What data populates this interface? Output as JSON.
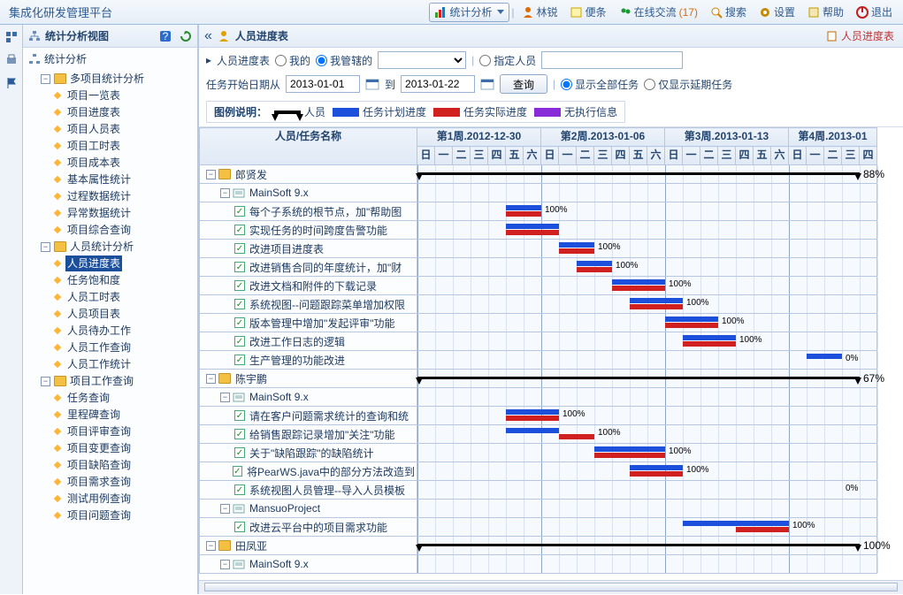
{
  "app_title": "集成化研发管理平台",
  "top_actions": {
    "stats_label": "统计分析",
    "user_label": "林锐",
    "sticky_label": "便条",
    "online_label": "在线交流",
    "online_count": "(17)",
    "search_label": "搜索",
    "settings_label": "设置",
    "help_label": "帮助",
    "exit_label": "退出"
  },
  "sidebar": {
    "title": "统计分析视图",
    "root_label": "统计分析",
    "groups": [
      {
        "label": "多项目统计分析",
        "items": [
          "项目一览表",
          "项目进度表",
          "项目人员表",
          "项目工时表",
          "项目成本表",
          "基本属性统计",
          "过程数据统计",
          "异常数据统计",
          "项目综合查询"
        ]
      },
      {
        "label": "人员统计分析",
        "items": [
          "人员进度表",
          "任务饱和度",
          "人员工时表",
          "人员项目表",
          "人员待办工作",
          "人员工作查询",
          "人员工作统计"
        ],
        "selected_index": 0
      },
      {
        "label": "项目工作查询",
        "items": [
          "任务查询",
          "里程碑查询",
          "项目评审查询",
          "项目变更查询",
          "项目缺陷查询",
          "项目需求查询",
          "测试用例查询",
          "项目问题查询"
        ]
      }
    ]
  },
  "content": {
    "title": "人员进度表",
    "tab_badge": "人员进度表",
    "chevron_label": "人员进度表",
    "radio_mine": "我的",
    "radio_managed": "我管辖的",
    "radio_specified": "指定人员",
    "date_label": "任务开始日期从",
    "date_from": "2013-01-01",
    "date_to_label": "到",
    "date_to": "2013-01-22",
    "query": "查询",
    "show_all": "显示全部任务",
    "show_delayed": "仅显示延期任务",
    "legend_title": "图例说明：",
    "legend_person": "人员",
    "legend_plan": "任务计划进度",
    "legend_actual": "任务实际进度",
    "legend_noexec": "无执行信息"
  },
  "gantt": {
    "col1header": "人员/任务名称",
    "week_prefix": "第",
    "week_suffix": "周",
    "date_sep": ".",
    "weeks": [
      {
        "num": "1",
        "date": "2012-12-30",
        "days": [
          "日",
          "一",
          "二",
          "三",
          "四",
          "五",
          "六"
        ]
      },
      {
        "num": "2",
        "date": "2013-01-06",
        "days": [
          "日",
          "一",
          "二",
          "三",
          "四",
          "五",
          "六"
        ]
      },
      {
        "num": "3",
        "date": "2013-01-13",
        "days": [
          "日",
          "一",
          "二",
          "三",
          "四",
          "五",
          "六"
        ]
      },
      {
        "num": "4",
        "date": "2013-01",
        "days": [
          "日",
          "一",
          "二",
          "三",
          "四"
        ]
      }
    ],
    "rows": [
      {
        "type": "person",
        "level": 0,
        "name": "郎贤发",
        "bar": [
          {
            "kind": "person",
            "s": 0,
            "e": 25,
            "pct": "88%"
          }
        ]
      },
      {
        "type": "project",
        "level": 1,
        "name": "MainSoft 9.x"
      },
      {
        "type": "task",
        "level": 2,
        "name": "每个子系统的根节点，加\"帮助图",
        "bars": [
          {
            "kind": "plan",
            "s": 5,
            "e": 7
          },
          {
            "kind": "act",
            "s": 5,
            "e": 7
          },
          {
            "kind": "pct",
            "at": 7,
            "v": "100%"
          }
        ]
      },
      {
        "type": "task",
        "level": 2,
        "name": "实现任务的时间跨度告警功能",
        "bars": [
          {
            "kind": "plan",
            "s": 5,
            "e": 8
          },
          {
            "kind": "act",
            "s": 5,
            "e": 8
          }
        ]
      },
      {
        "type": "task",
        "level": 2,
        "name": "改进项目进度表",
        "bars": [
          {
            "kind": "plan",
            "s": 8,
            "e": 10
          },
          {
            "kind": "act",
            "s": 8,
            "e": 10
          },
          {
            "kind": "pct",
            "at": 10,
            "v": "100%"
          }
        ]
      },
      {
        "type": "task",
        "level": 2,
        "name": "改进销售合同的年度统计，加\"财",
        "bars": [
          {
            "kind": "plan",
            "s": 9,
            "e": 11
          },
          {
            "kind": "act",
            "s": 9,
            "e": 11
          },
          {
            "kind": "pct",
            "at": 11,
            "v": "100%"
          }
        ]
      },
      {
        "type": "task",
        "level": 2,
        "name": "改进文档和附件的下载记录",
        "bars": [
          {
            "kind": "plan",
            "s": 11,
            "e": 14
          },
          {
            "kind": "act",
            "s": 11,
            "e": 14
          },
          {
            "kind": "pct",
            "at": 14,
            "v": "100%"
          }
        ]
      },
      {
        "type": "task",
        "level": 2,
        "name": "系统视图--问题跟踪菜单增加权限",
        "bars": [
          {
            "kind": "plan",
            "s": 12,
            "e": 15
          },
          {
            "kind": "act",
            "s": 12,
            "e": 15
          },
          {
            "kind": "pct",
            "at": 15,
            "v": "100%"
          }
        ]
      },
      {
        "type": "task",
        "level": 2,
        "name": "版本管理中增加\"发起评审\"功能",
        "bars": [
          {
            "kind": "plan",
            "s": 14,
            "e": 17
          },
          {
            "kind": "act",
            "s": 14,
            "e": 17
          },
          {
            "kind": "pct",
            "at": 17,
            "v": "100%"
          }
        ]
      },
      {
        "type": "task",
        "level": 2,
        "name": "改进工作日志的逻辑",
        "bars": [
          {
            "kind": "plan",
            "s": 15,
            "e": 18
          },
          {
            "kind": "act",
            "s": 15,
            "e": 18
          },
          {
            "kind": "pct",
            "at": 18,
            "v": "100%"
          }
        ]
      },
      {
        "type": "task",
        "level": 2,
        "name": "生产管理的功能改进",
        "bars": [
          {
            "kind": "plan",
            "s": 22,
            "e": 24
          },
          {
            "kind": "pct",
            "at": 24,
            "v": "0%"
          }
        ]
      },
      {
        "type": "person",
        "level": 0,
        "name": "陈宇鹏",
        "bar": [
          {
            "kind": "person",
            "s": 0,
            "e": 25,
            "pct": "67%"
          }
        ]
      },
      {
        "type": "project",
        "level": 1,
        "name": "MainSoft 9.x"
      },
      {
        "type": "task",
        "level": 2,
        "name": "请在客户问题需求统计的查询和统",
        "bars": [
          {
            "kind": "plan",
            "s": 5,
            "e": 8
          },
          {
            "kind": "act",
            "s": 5,
            "e": 8
          },
          {
            "kind": "pct",
            "at": 8,
            "v": "100%"
          }
        ]
      },
      {
        "type": "task",
        "level": 2,
        "name": "给销售跟踪记录增加\"关注\"功能",
        "bars": [
          {
            "kind": "plan",
            "s": 5,
            "e": 8
          },
          {
            "kind": "act",
            "s": 8,
            "e": 10
          },
          {
            "kind": "pct",
            "at": 10,
            "v": "100%"
          }
        ]
      },
      {
        "type": "task",
        "level": 2,
        "name": "关于\"缺陷跟踪\"的缺陷统计",
        "bars": [
          {
            "kind": "plan",
            "s": 10,
            "e": 14
          },
          {
            "kind": "act",
            "s": 10,
            "e": 14
          },
          {
            "kind": "pct",
            "at": 14,
            "v": "100%"
          }
        ]
      },
      {
        "type": "task",
        "level": 2,
        "name": "将PearWS.java中的部分方法改造到",
        "bars": [
          {
            "kind": "plan",
            "s": 12,
            "e": 15
          },
          {
            "kind": "act",
            "s": 12,
            "e": 15
          },
          {
            "kind": "pct",
            "at": 15,
            "v": "100%"
          }
        ]
      },
      {
        "type": "task",
        "level": 2,
        "name": "系统视图人员管理--导入人员模板",
        "bars": [
          {
            "kind": "pct",
            "at": 24,
            "v": "0%"
          }
        ]
      },
      {
        "type": "project",
        "level": 1,
        "name": "MansuoProject"
      },
      {
        "type": "task",
        "level": 2,
        "name": "改进云平台中的项目需求功能",
        "bars": [
          {
            "kind": "plan",
            "s": 15,
            "e": 21
          },
          {
            "kind": "act",
            "s": 18,
            "e": 21
          },
          {
            "kind": "pct",
            "at": 21,
            "v": "100%"
          }
        ]
      },
      {
        "type": "person",
        "level": 0,
        "name": "田凤亚",
        "bar": [
          {
            "kind": "person",
            "s": 0,
            "e": 25,
            "pct": "100%"
          }
        ]
      },
      {
        "type": "project",
        "level": 1,
        "name": "MainSoft 9.x"
      }
    ]
  },
  "chart_data": {
    "type": "table",
    "note": "Gantt timeline per row; s/e are day indices from week1-Sunday (0-based), pct is label",
    "rows_ref": "gantt.rows"
  }
}
